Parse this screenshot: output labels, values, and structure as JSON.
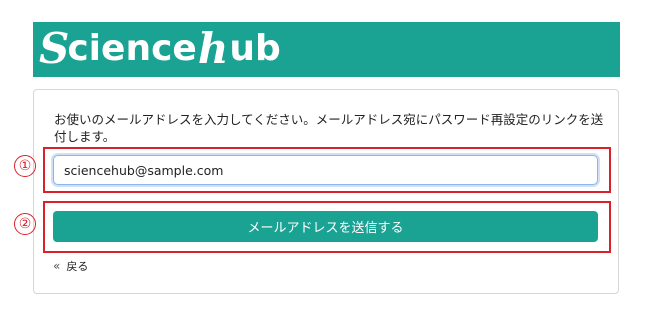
{
  "brand": {
    "logo_s": "S",
    "logo_mid": "cience",
    "logo_h": "h",
    "logo_end": "ub",
    "color": "#1aa293"
  },
  "form": {
    "description": "お使いのメールアドレスを入力してください。メールアドレス宛にパスワード再設定のリンクを送付します。",
    "email_value": "sciencehub@sample.com",
    "submit_label": "メールアドレスを送信する",
    "back_label": "戻る",
    "back_icon": "double-chevron-left-icon"
  },
  "annotations": {
    "one": "①",
    "two": "②",
    "color": "#d9212a"
  }
}
